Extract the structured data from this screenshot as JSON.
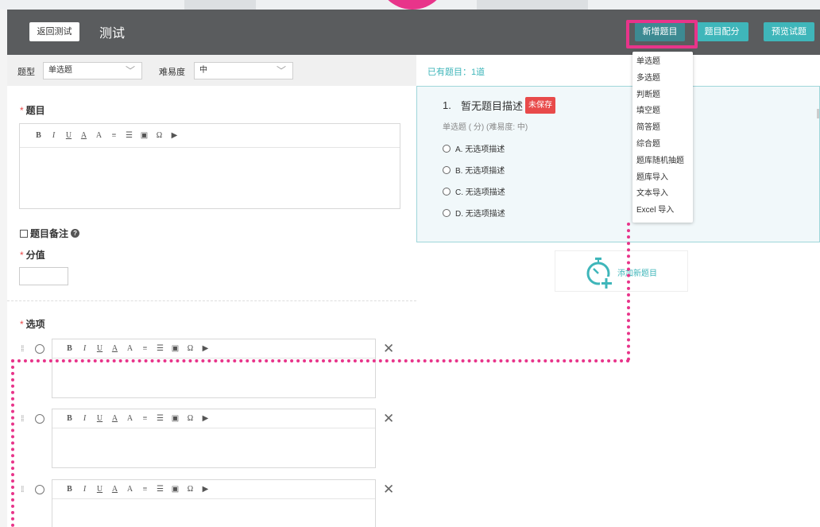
{
  "header": {
    "back_label": "返回测试",
    "title": "测试",
    "add_label": "新增题目",
    "score_label": "题目配分",
    "preview_label": "预览试题"
  },
  "filters": {
    "type_label": "题型",
    "type_value": "单选题",
    "difficulty_label": "难易度",
    "difficulty_value": "中"
  },
  "form": {
    "question_label": "题目",
    "note_label": "题目备注",
    "score_label": "分值",
    "options_label": "选项",
    "required_mark": "*",
    "help_glyph": "?",
    "toolbar_buttons": [
      "B",
      "I",
      "U",
      "A",
      "A",
      "≡",
      "☰",
      "▣",
      "Ω",
      "▶"
    ],
    "close_glyph": "✕",
    "drag_glyph": "⁞⁞"
  },
  "preview": {
    "count_label": "已有题目：",
    "count_value": "1道",
    "q_number": "1.",
    "q_title": "暂无题目描述",
    "unsaved_badge": "未保存",
    "q_meta": "单选题 ( 分)  (难易度: 中)",
    "options": [
      "A. 无选项描述",
      "B. 无选项描述",
      "C. 无选项描述",
      "D. 无选项描述"
    ],
    "add_new_label": "添加新题目"
  },
  "dropdown": {
    "items": [
      "单选题",
      "多选题",
      "判断题",
      "填空题",
      "简答题",
      "综合题",
      "题库随机抽题",
      "题库导入",
      "文本导入",
      "Excel 导入"
    ]
  },
  "colors": {
    "header_bg": "#5a5c5e",
    "accent_teal": "#3fb6ba",
    "highlight_pink": "#e8348a",
    "unsaved_red": "#e84a4a"
  }
}
